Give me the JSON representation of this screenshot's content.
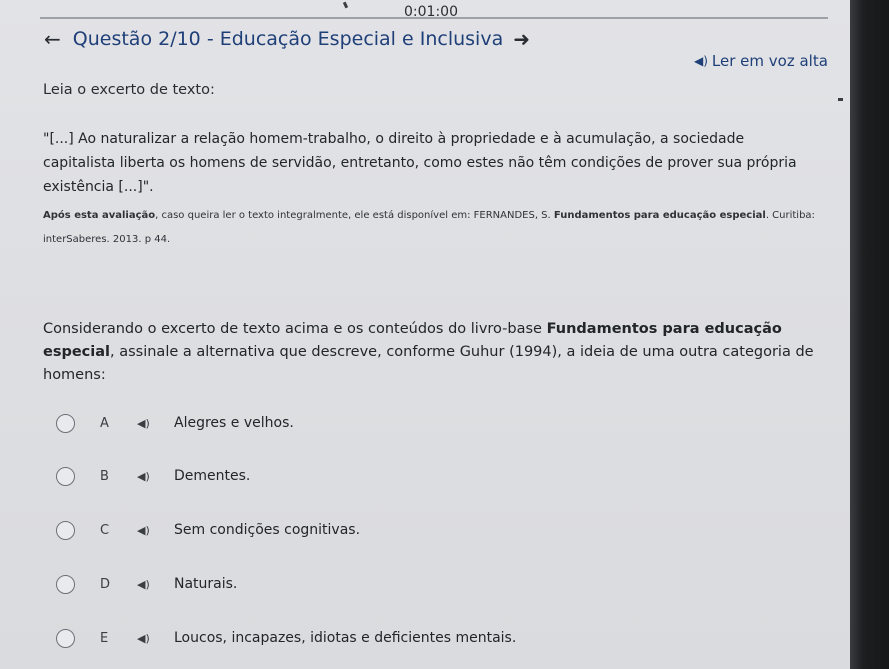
{
  "timer": "0:01:00",
  "header": {
    "title": "Questão 2/10 - Educação Especial e Inclusiva"
  },
  "read_aloud_label": "Ler em voz alta",
  "intro": "Leia o excerto de texto:",
  "quote": "\"[...] Ao naturalizar a relação homem-trabalho, o direito à propriedade e à acumulação, a sociedade capitalista liberta os homens de servidão, entretanto, como estes não têm condições de prover sua própria existência [...]\".",
  "citation": {
    "lead_bold": "Após esta avaliação",
    "text": ", caso queira ler o texto integralmente, ele está disponível em: FERNANDES, S. ",
    "book_bold": "Fundamentos para educação especial",
    "tail": ". Curitiba: interSaberes. 2013. p 44."
  },
  "question": {
    "part1": "Considerando o excerto de texto acima e os conteúdos do livro-base ",
    "book_bold": "Fundamentos para educação especial",
    "part2": ", assinale a alternativa que descreve, conforme Guhur (1994), a ideia de uma outra categoria de homens:"
  },
  "options": [
    {
      "letter": "A",
      "text": "Alegres e velhos."
    },
    {
      "letter": "B",
      "text": "Dementes."
    },
    {
      "letter": "C",
      "text": "Sem condições cognitivas."
    },
    {
      "letter": "D",
      "text": "Naturais."
    },
    {
      "letter": "E",
      "text": "Loucos, incapazes, idiotas e deficientes mentais."
    }
  ],
  "icons": {
    "back": "arrow-left-icon",
    "next": "arrow-right-icon",
    "speaker": "speaker-icon",
    "radio": "radio-button"
  }
}
